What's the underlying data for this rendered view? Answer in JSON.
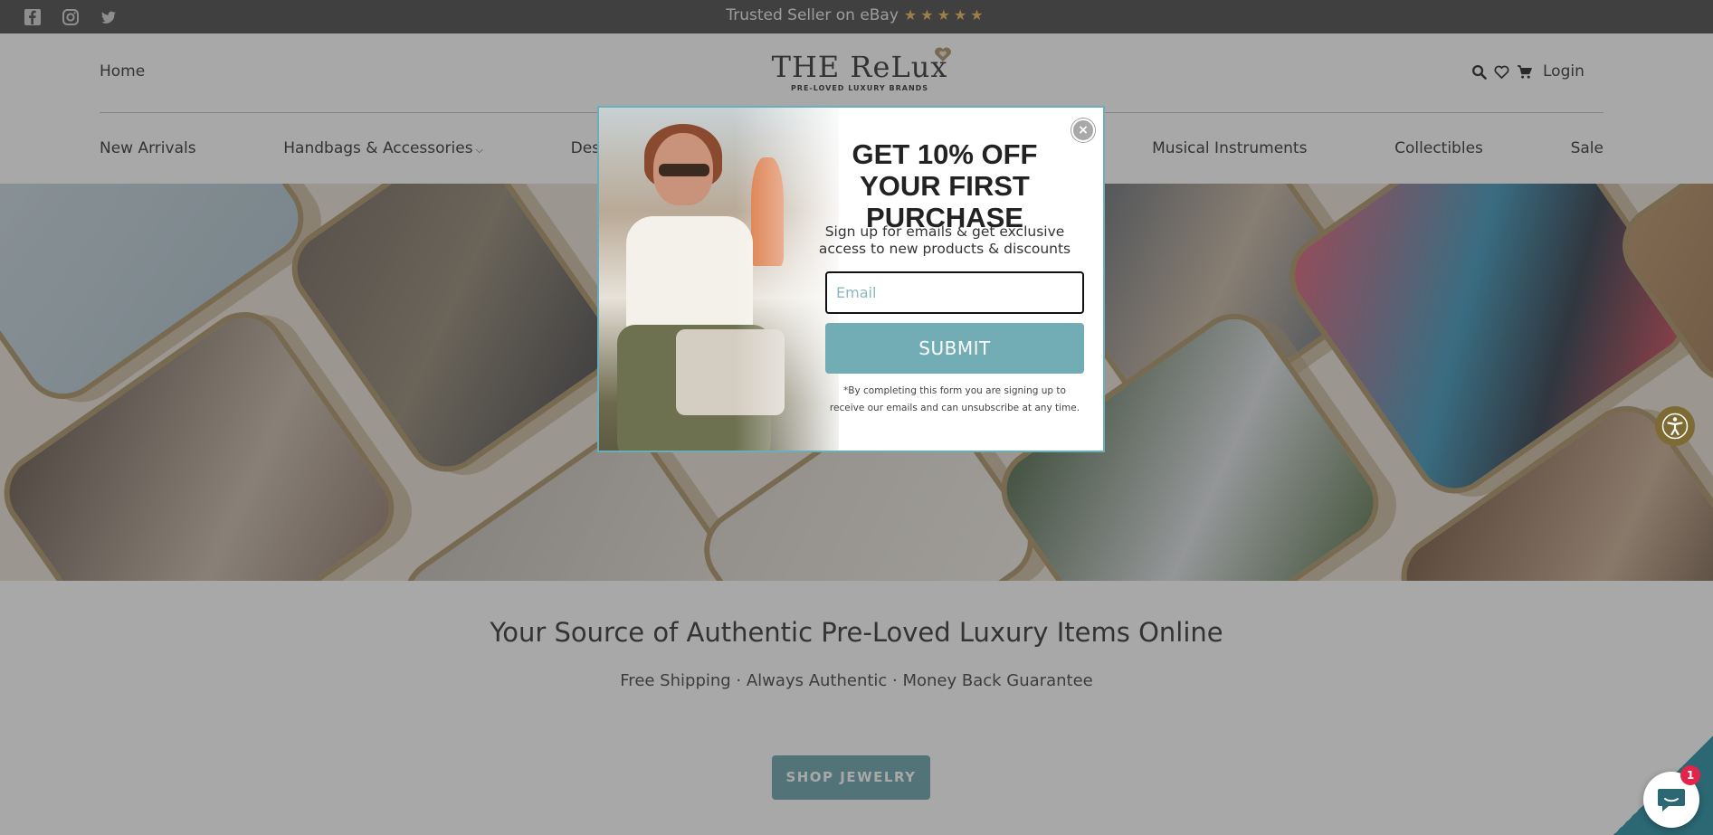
{
  "topbar": {
    "social": [
      "facebook-icon",
      "instagram-icon",
      "twitter-icon"
    ],
    "trusted_text": "Trusted Seller on eBay",
    "stars": "★★★★★",
    "star_color": "#e6b04a"
  },
  "header": {
    "home": "Home",
    "logo_main": "THE ReLux",
    "logo_sub": "PRE-LOVED LUXURY BRANDS",
    "icons": [
      "search-icon",
      "heart-icon",
      "cart-icon"
    ],
    "login": "Login"
  },
  "nav": {
    "items": [
      {
        "label": "New Arrivals"
      },
      {
        "label": "Handbags & Accessories",
        "has_caret": true
      },
      {
        "label": "Designe"
      },
      {
        "label": "Musical Instruments"
      },
      {
        "label": "Collectibles"
      },
      {
        "label": "Sale"
      }
    ]
  },
  "main": {
    "headline": "Your Source of Authentic Pre-Loved Luxury Items Online",
    "subline": "Free Shipping · Always Authentic · Money Back Guarantee",
    "shop_button": "SHOP JEWELRY",
    "button_color": "#5e9ca5"
  },
  "popup": {
    "title": "GET 10% OFF YOUR FIRST PURCHASE",
    "description": "Sign up for emails & get exclusive access to new products & discounts",
    "email_placeholder": "Email",
    "email_value": "",
    "submit_label": "SUBMIT",
    "disclaimer": "*By completing this form you are signing up to receive our emails and can unsubscribe at any time.",
    "close_symbol": "×",
    "accent": "#72adb6"
  },
  "widgets": {
    "chat_badge": "1",
    "accessibility_icon": "accessibility-icon",
    "chat_icon": "chat-icon"
  }
}
